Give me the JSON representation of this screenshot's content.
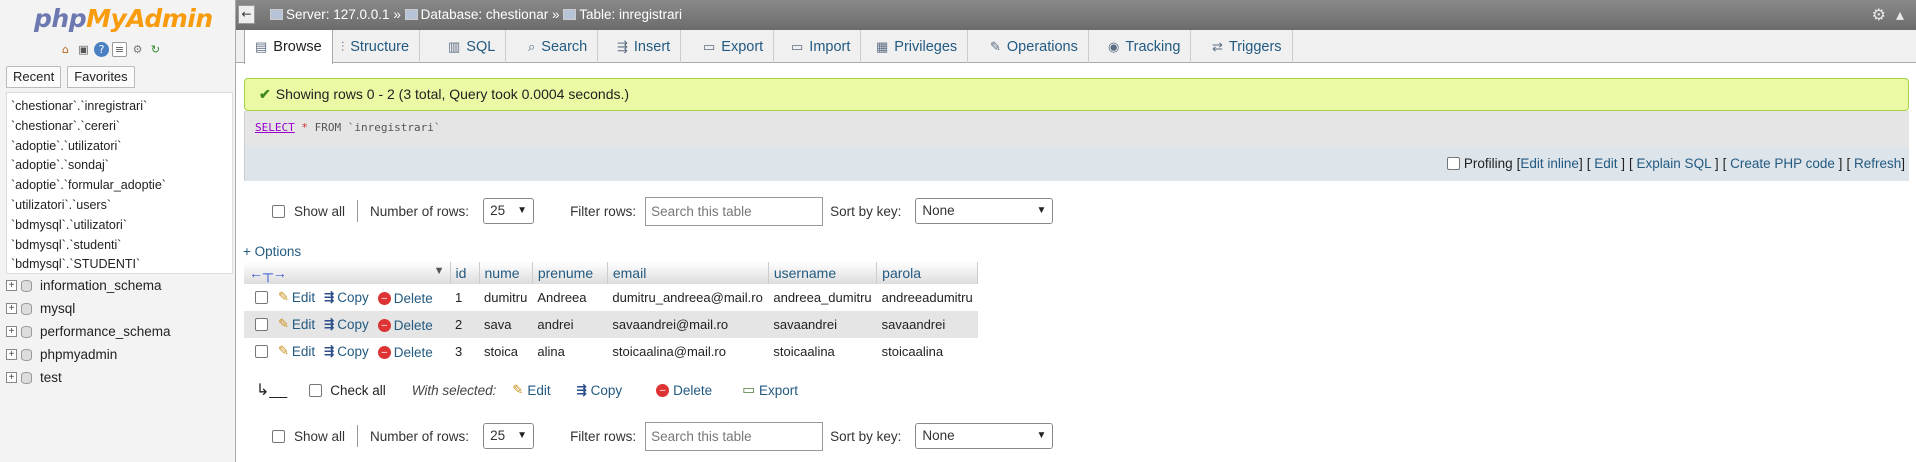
{
  "nav": {
    "logo_php": "php",
    "logo_admin": "MyAdmin",
    "tabs": [
      "Recent",
      "Favorites"
    ],
    "recent": [
      "`chestionar`.`inregistrari`",
      "`chestionar`.`cereri`",
      "`adoptie`.`utilizatori`",
      "`adoptie`.`sondaj`",
      "`adoptie`.`formular_adoptie`",
      "`utilizatori`.`users`",
      "`bdmysql`.`utilizatori`",
      "`bdmysql`.`studenti`",
      "`bdmysql`.`STUDENTI`"
    ],
    "databases": [
      "information_schema",
      "mysql",
      "performance_schema",
      "phpmyadmin",
      "test"
    ]
  },
  "topbar": {
    "server": "Server: 127.0.0.1",
    "database": "Database: chestionar",
    "table": "Table: inregistrari",
    "sep": "»"
  },
  "tabs": [
    {
      "label": "Browse",
      "icon": "browse-icon"
    },
    {
      "label": "Structure",
      "icon": "structure-icon"
    },
    {
      "label": "SQL",
      "icon": "sql-icon"
    },
    {
      "label": "Search",
      "icon": "search-icon"
    },
    {
      "label": "Insert",
      "icon": "insert-icon"
    },
    {
      "label": "Export",
      "icon": "export-icon"
    },
    {
      "label": "Import",
      "icon": "import-icon"
    },
    {
      "label": "Privileges",
      "icon": "privileges-icon"
    },
    {
      "label": "Operations",
      "icon": "operations-icon"
    },
    {
      "label": "Tracking",
      "icon": "tracking-icon"
    },
    {
      "label": "Triggers",
      "icon": "triggers-icon"
    }
  ],
  "message": "Showing rows 0 - 2 (3 total, Query took 0.0004 seconds.)",
  "sql": {
    "select": "SELECT",
    "star": "*",
    "rest": "FROM `inregistrari`"
  },
  "sql_tools": {
    "profiling": "Profiling",
    "edit_inline": "Edit inline",
    "edit": "Edit",
    "explain": "Explain SQL",
    "create_php": "Create PHP code",
    "refresh": "Refresh"
  },
  "controls": {
    "show_all": "Show all",
    "rows_label": "Number of rows:",
    "rows_value": "25",
    "filter_label": "Filter rows:",
    "filter_placeholder": "Search this table",
    "sort_label": "Sort by key:",
    "sort_value": "None"
  },
  "options": "+ Options",
  "table": {
    "columns": [
      "id",
      "nume",
      "prenume",
      "email",
      "username",
      "parola"
    ],
    "actions": {
      "edit": "Edit",
      "copy": "Copy",
      "delete": "Delete"
    },
    "rows": [
      [
        "1",
        "dumitru",
        "Andreea",
        "dumitru_andreea@mail.ro",
        "andreea_dumitru",
        "andreeadumitru"
      ],
      [
        "2",
        "sava",
        "andrei",
        "savaandrei@mail.ro",
        "savaandrei",
        "savaandrei"
      ],
      [
        "3",
        "stoica",
        "alina",
        "stoicaalina@mail.ro",
        "stoicaalina",
        "stoicaalina"
      ]
    ]
  },
  "bulk": {
    "check_all": "Check all",
    "with_selected": "With selected:",
    "edit": "Edit",
    "copy": "Copy",
    "delete": "Delete",
    "export": "Export"
  }
}
